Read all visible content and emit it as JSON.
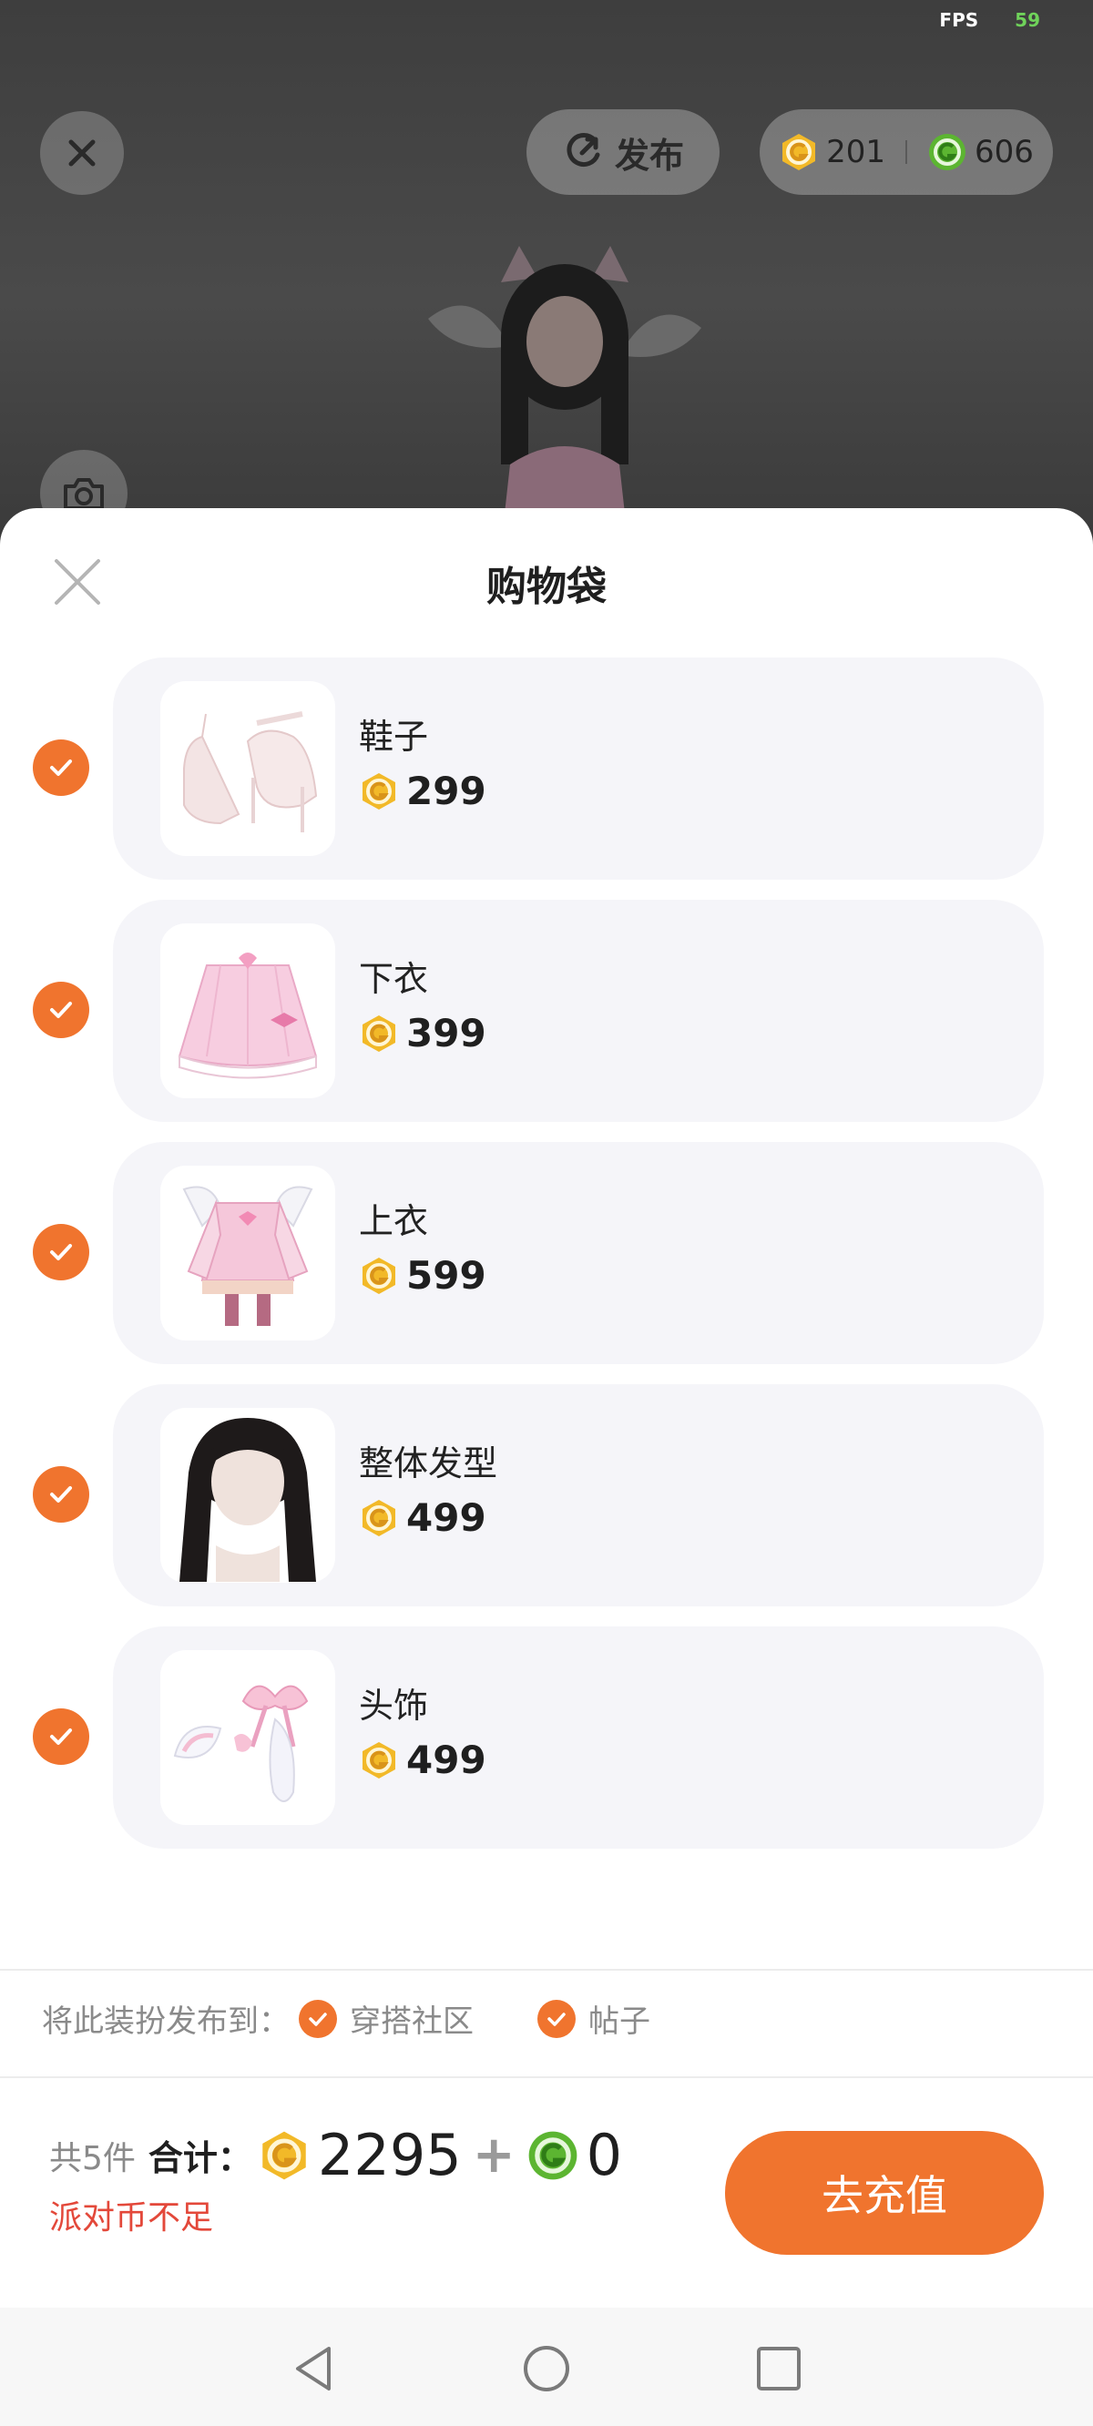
{
  "status": {
    "fps_label": "FPS",
    "fps_value": "59"
  },
  "topbar": {
    "publish_label": "发布",
    "gold_coins": "201",
    "green_coins": "606"
  },
  "sheet": {
    "title": "购物袋",
    "items": [
      {
        "name": "鞋子",
        "price": "299",
        "checked": true
      },
      {
        "name": "下衣",
        "price": "399",
        "checked": true
      },
      {
        "name": "上衣",
        "price": "599",
        "checked": true
      },
      {
        "name": "整体发型",
        "price": "499",
        "checked": true
      },
      {
        "name": "头饰",
        "price": "499",
        "checked": true
      }
    ],
    "publish": {
      "label": "将此装扮发布到：",
      "option1": "穿搭社区",
      "option2": "帖子"
    },
    "footer": {
      "count_text": "共5件",
      "sum_label": "合计：",
      "gold_total": "2295",
      "plus": "+",
      "green_total": "0",
      "warning": "派对币不足",
      "recharge_label": "去充值"
    }
  },
  "colors": {
    "accent": "#f0742e",
    "gold": "#f2b928",
    "green": "#5cb531",
    "warning": "#e3483a"
  },
  "icons": [
    "close-icon",
    "publish-refresh-icon",
    "gold-coin-icon",
    "green-coin-icon",
    "camera-icon",
    "check-icon",
    "back-icon",
    "home-icon",
    "recents-icon"
  ]
}
